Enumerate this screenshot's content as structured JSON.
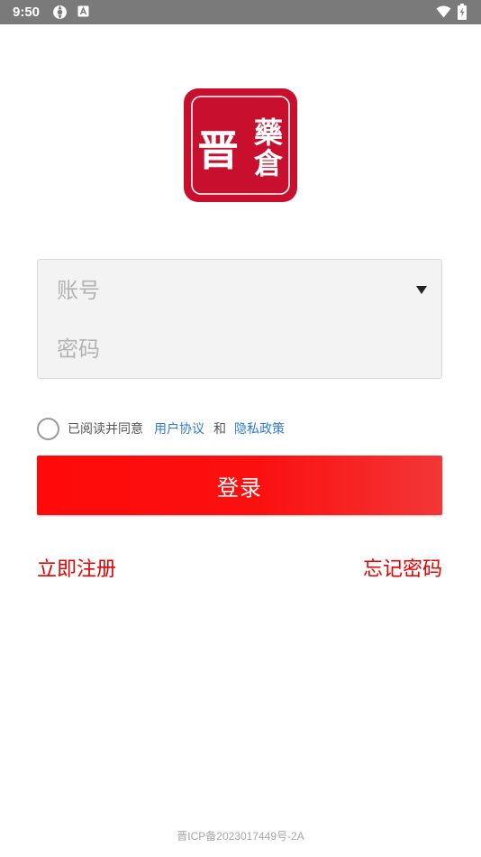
{
  "status_bar": {
    "time": "9:50",
    "icons": [
      "sync-icon",
      "a-badge-icon",
      "wifi-icon",
      "battery-charging-icon"
    ]
  },
  "logo": {
    "name": "app-logo",
    "main_char": "晋",
    "side_chars": [
      "藥",
      "倉"
    ],
    "brand_color": "#c8102e"
  },
  "form": {
    "account_placeholder": "账号",
    "account_value": "",
    "password_placeholder": "密码",
    "password_value": "",
    "dropdown_icon": "caret-down-icon"
  },
  "agreement": {
    "checked": false,
    "prefix": "已阅读并同意",
    "user_agreement": "用户协议",
    "and": "和",
    "privacy_policy": "隐私政策"
  },
  "login_button": {
    "label": "登录"
  },
  "links": {
    "register": "立即注册",
    "forgot_password": "忘记密码"
  },
  "footer": {
    "icp": "晋ICP备2023017449号-2A"
  },
  "colors": {
    "accent_red": "#ff0a0a",
    "link_red": "#e60000",
    "link_blue": "#2f7ad6",
    "status_bar": "#7a7a7a"
  }
}
